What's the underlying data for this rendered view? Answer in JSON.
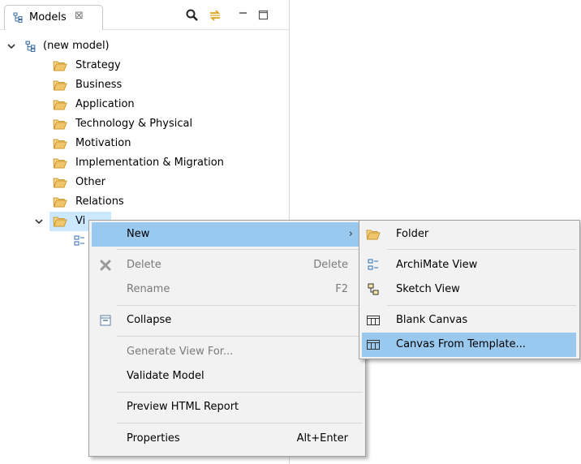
{
  "view": {
    "tab_title": "Models",
    "tab_close": "⊠",
    "toolbar": {
      "search_icon": "search-icon",
      "sync_icon": "link-with-editor-icon",
      "minimize_icon": "minimize-icon",
      "maximize_icon": "maximize-icon"
    }
  },
  "tree": {
    "root_label": "(new model)",
    "folders": [
      "Strategy",
      "Business",
      "Application",
      "Technology & Physical",
      "Motivation",
      "Implementation & Migration",
      "Other",
      "Relations"
    ],
    "views_label": "Vi"
  },
  "context_menu": {
    "new": "New",
    "delete": "Delete",
    "delete_key": "Delete",
    "rename": "Rename",
    "rename_key": "F2",
    "collapse": "Collapse",
    "generate_view": "Generate View For...",
    "validate_model": "Validate Model",
    "preview_html": "Preview HTML Report",
    "properties": "Properties",
    "properties_key": "Alt+Enter",
    "submenu_arrow": "›"
  },
  "submenu": {
    "folder": "Folder",
    "archimate_view": "ArchiMate View",
    "sketch_view": "Sketch View",
    "blank_canvas": "Blank Canvas",
    "canvas_from_template": "Canvas From Template..."
  },
  "colors": {
    "selection": "#cce8ff",
    "menu_highlight": "#99c9ef",
    "folder": "#f2c66d",
    "folder_border": "#c9982f",
    "menu_bg": "#f2f2f2"
  }
}
